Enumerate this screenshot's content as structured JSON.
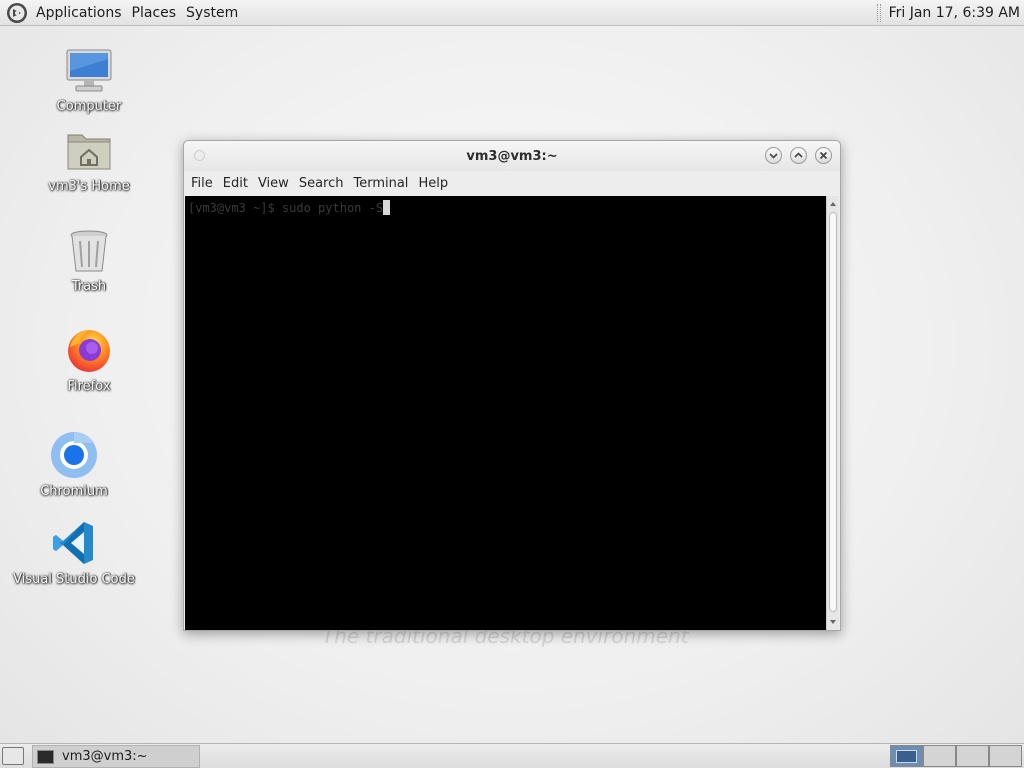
{
  "top_panel": {
    "menus": [
      "Applications",
      "Places",
      "System"
    ],
    "clock": "Fri Jan 17,  6:39 AM"
  },
  "desktop": {
    "icons": [
      {
        "label": "Computer",
        "icon": "computer-icon"
      },
      {
        "label": "vm3's Home",
        "icon": "home-folder-icon"
      },
      {
        "label": "Trash",
        "icon": "trash-icon"
      },
      {
        "label": "Firefox",
        "icon": "firefox-icon"
      },
      {
        "label": "Chromium",
        "icon": "chromium-icon"
      },
      {
        "label": "Visual Studio Code",
        "icon": "vscode-icon"
      }
    ],
    "watermark": "The traditional desktop environment"
  },
  "terminal": {
    "title": "vm3@vm3:~",
    "menu": [
      "File",
      "Edit",
      "View",
      "Search",
      "Terminal",
      "Help"
    ],
    "line": "[vm3@vm3 ~]$ sudo python -S"
  },
  "taskbar": {
    "window_label": "vm3@vm3:~"
  },
  "colors": {
    "terminal_bg": "#000000",
    "workspace_active": "#6d8db3",
    "panel_bg": "#e6e6e6"
  }
}
